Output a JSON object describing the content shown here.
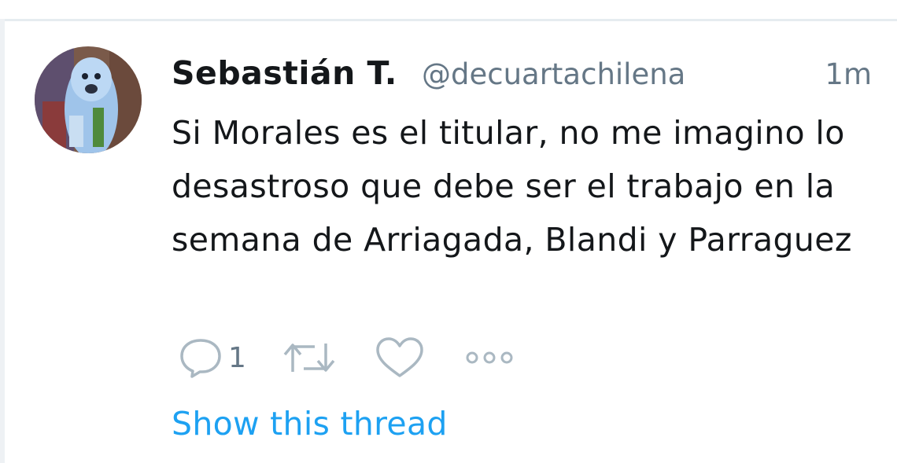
{
  "tweet": {
    "display_name": "Sebastián T.",
    "handle": "@decuartachilena",
    "timestamp": "1m",
    "text": "Si Morales es el titular, no me imagino lo desastroso que debe ser el trabajo en la semana de Arriagada, Blandi y Parraguez",
    "reply_count": "1",
    "show_thread_label": "Show this thread"
  },
  "icons": {
    "reply": "reply-icon",
    "retweet": "retweet-icon",
    "like": "heart-icon",
    "more": "more-icon"
  },
  "colors": {
    "text": "#14171a",
    "secondary": "#657786",
    "link": "#1da1f2",
    "icon": "#aab8c2"
  }
}
